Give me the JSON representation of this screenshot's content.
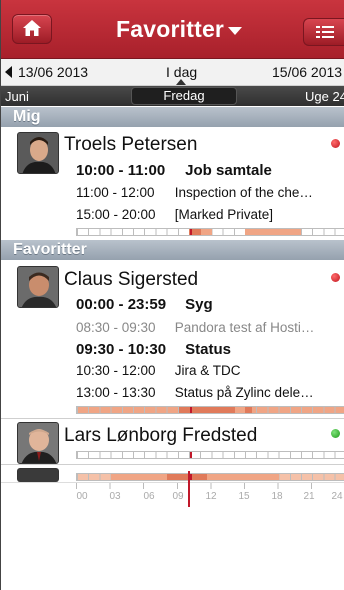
{
  "header": {
    "title": "Favoritter",
    "home_icon": "home-icon",
    "menu_icon": "menu-icon"
  },
  "dates": {
    "prev": "13/06 2013",
    "today": "I dag",
    "next": "15/06 2013"
  },
  "info": {
    "month": "Juni",
    "day": "Fredag",
    "week": "Uge 24"
  },
  "sections": {
    "mig": "Mig",
    "favoritter": "Favoritter"
  },
  "people": [
    {
      "name": "Troels Petersen",
      "status_color": "#c0151f",
      "events": [
        {
          "time": "10:00 - 11:00",
          "title": "Job samtale",
          "style": "bold"
        },
        {
          "time": "11:00 - 12:00",
          "title": "Inspection of the che…",
          "style": "normal"
        },
        {
          "time": "15:00 - 20:00",
          "title": "[Marked Private]",
          "style": "normal"
        }
      ]
    },
    {
      "name": "Claus Sigersted",
      "status_color": "#c0151f",
      "events": [
        {
          "time": "00:00 - 23:59",
          "title": "Syg",
          "style": "bold"
        },
        {
          "time": "08:30 - 09:30",
          "title": "Pandora test af Hosti…",
          "style": "gray"
        },
        {
          "time": "09:30 - 10:30",
          "title": "Status",
          "style": "bold"
        },
        {
          "time": "10:30 - 12:00",
          "title": "Jira & TDC",
          "style": "normal"
        },
        {
          "time": "13:00 - 13:30",
          "title": "Status på Zylinc dele…",
          "style": "normal"
        }
      ]
    },
    {
      "name": "Lars Lønborg Fredsted",
      "status_color": "#1f9a1a",
      "events": []
    }
  ],
  "axis": {
    "hours": [
      "00",
      "03",
      "06",
      "09",
      "12",
      "15",
      "18",
      "21",
      "24"
    ]
  },
  "colors": {
    "accent": "#b3222d",
    "busy": "#f0a585",
    "busy_strong": "#e07a5a",
    "now_marker": "#c1182a"
  }
}
